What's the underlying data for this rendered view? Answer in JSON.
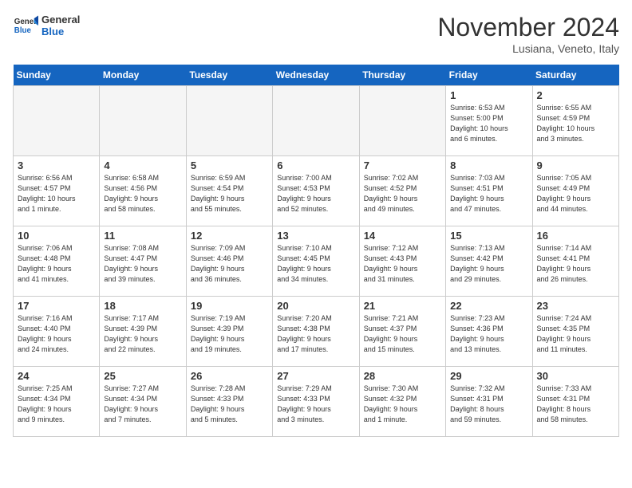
{
  "logo": {
    "text_general": "General",
    "text_blue": "Blue"
  },
  "header": {
    "month": "November 2024",
    "location": "Lusiana, Veneto, Italy"
  },
  "weekdays": [
    "Sunday",
    "Monday",
    "Tuesday",
    "Wednesday",
    "Thursday",
    "Friday",
    "Saturday"
  ],
  "weeks": [
    [
      {
        "day": "",
        "info": ""
      },
      {
        "day": "",
        "info": ""
      },
      {
        "day": "",
        "info": ""
      },
      {
        "day": "",
        "info": ""
      },
      {
        "day": "",
        "info": ""
      },
      {
        "day": "1",
        "info": "Sunrise: 6:53 AM\nSunset: 5:00 PM\nDaylight: 10 hours\nand 6 minutes."
      },
      {
        "day": "2",
        "info": "Sunrise: 6:55 AM\nSunset: 4:59 PM\nDaylight: 10 hours\nand 3 minutes."
      }
    ],
    [
      {
        "day": "3",
        "info": "Sunrise: 6:56 AM\nSunset: 4:57 PM\nDaylight: 10 hours\nand 1 minute."
      },
      {
        "day": "4",
        "info": "Sunrise: 6:58 AM\nSunset: 4:56 PM\nDaylight: 9 hours\nand 58 minutes."
      },
      {
        "day": "5",
        "info": "Sunrise: 6:59 AM\nSunset: 4:54 PM\nDaylight: 9 hours\nand 55 minutes."
      },
      {
        "day": "6",
        "info": "Sunrise: 7:00 AM\nSunset: 4:53 PM\nDaylight: 9 hours\nand 52 minutes."
      },
      {
        "day": "7",
        "info": "Sunrise: 7:02 AM\nSunset: 4:52 PM\nDaylight: 9 hours\nand 49 minutes."
      },
      {
        "day": "8",
        "info": "Sunrise: 7:03 AM\nSunset: 4:51 PM\nDaylight: 9 hours\nand 47 minutes."
      },
      {
        "day": "9",
        "info": "Sunrise: 7:05 AM\nSunset: 4:49 PM\nDaylight: 9 hours\nand 44 minutes."
      }
    ],
    [
      {
        "day": "10",
        "info": "Sunrise: 7:06 AM\nSunset: 4:48 PM\nDaylight: 9 hours\nand 41 minutes."
      },
      {
        "day": "11",
        "info": "Sunrise: 7:08 AM\nSunset: 4:47 PM\nDaylight: 9 hours\nand 39 minutes."
      },
      {
        "day": "12",
        "info": "Sunrise: 7:09 AM\nSunset: 4:46 PM\nDaylight: 9 hours\nand 36 minutes."
      },
      {
        "day": "13",
        "info": "Sunrise: 7:10 AM\nSunset: 4:45 PM\nDaylight: 9 hours\nand 34 minutes."
      },
      {
        "day": "14",
        "info": "Sunrise: 7:12 AM\nSunset: 4:43 PM\nDaylight: 9 hours\nand 31 minutes."
      },
      {
        "day": "15",
        "info": "Sunrise: 7:13 AM\nSunset: 4:42 PM\nDaylight: 9 hours\nand 29 minutes."
      },
      {
        "day": "16",
        "info": "Sunrise: 7:14 AM\nSunset: 4:41 PM\nDaylight: 9 hours\nand 26 minutes."
      }
    ],
    [
      {
        "day": "17",
        "info": "Sunrise: 7:16 AM\nSunset: 4:40 PM\nDaylight: 9 hours\nand 24 minutes."
      },
      {
        "day": "18",
        "info": "Sunrise: 7:17 AM\nSunset: 4:39 PM\nDaylight: 9 hours\nand 22 minutes."
      },
      {
        "day": "19",
        "info": "Sunrise: 7:19 AM\nSunset: 4:39 PM\nDaylight: 9 hours\nand 19 minutes."
      },
      {
        "day": "20",
        "info": "Sunrise: 7:20 AM\nSunset: 4:38 PM\nDaylight: 9 hours\nand 17 minutes."
      },
      {
        "day": "21",
        "info": "Sunrise: 7:21 AM\nSunset: 4:37 PM\nDaylight: 9 hours\nand 15 minutes."
      },
      {
        "day": "22",
        "info": "Sunrise: 7:23 AM\nSunset: 4:36 PM\nDaylight: 9 hours\nand 13 minutes."
      },
      {
        "day": "23",
        "info": "Sunrise: 7:24 AM\nSunset: 4:35 PM\nDaylight: 9 hours\nand 11 minutes."
      }
    ],
    [
      {
        "day": "24",
        "info": "Sunrise: 7:25 AM\nSunset: 4:34 PM\nDaylight: 9 hours\nand 9 minutes."
      },
      {
        "day": "25",
        "info": "Sunrise: 7:27 AM\nSunset: 4:34 PM\nDaylight: 9 hours\nand 7 minutes."
      },
      {
        "day": "26",
        "info": "Sunrise: 7:28 AM\nSunset: 4:33 PM\nDaylight: 9 hours\nand 5 minutes."
      },
      {
        "day": "27",
        "info": "Sunrise: 7:29 AM\nSunset: 4:33 PM\nDaylight: 9 hours\nand 3 minutes."
      },
      {
        "day": "28",
        "info": "Sunrise: 7:30 AM\nSunset: 4:32 PM\nDaylight: 9 hours\nand 1 minute."
      },
      {
        "day": "29",
        "info": "Sunrise: 7:32 AM\nSunset: 4:31 PM\nDaylight: 8 hours\nand 59 minutes."
      },
      {
        "day": "30",
        "info": "Sunrise: 7:33 AM\nSunset: 4:31 PM\nDaylight: 8 hours\nand 58 minutes."
      }
    ]
  ]
}
